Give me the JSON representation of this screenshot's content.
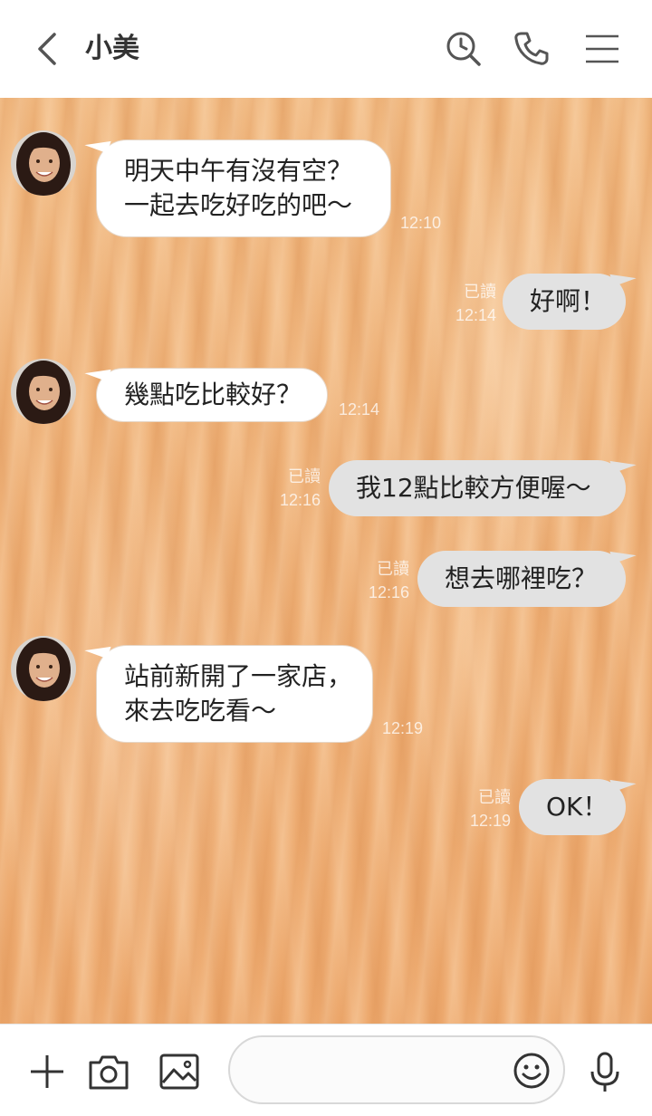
{
  "header": {
    "contact_name": "小美",
    "icons": [
      "back-icon",
      "search-history-icon",
      "phone-icon",
      "menu-icon"
    ]
  },
  "messages": [
    {
      "side": "in",
      "text": "明天中午有沒有空？\n一起去吃好吃的吧～",
      "time": "12:10"
    },
    {
      "side": "out",
      "text": "好啊！",
      "read": "已讀",
      "time": "12:14"
    },
    {
      "side": "in",
      "text": "幾點吃比較好？",
      "time": "12:14"
    },
    {
      "side": "out",
      "text": "我12點比較方便喔～",
      "read": "已讀",
      "time": "12:16"
    },
    {
      "side": "out",
      "text": "想去哪裡吃？",
      "read": "已讀",
      "time": "12:16"
    },
    {
      "side": "in",
      "text": "站前新開了一家店，\n來去吃吃看～",
      "time": "12:19"
    },
    {
      "side": "out",
      "text": "OK！",
      "read": "已讀",
      "time": "12:19"
    }
  ],
  "footer": {
    "input_value": "",
    "icons": [
      "plus-icon",
      "camera-icon",
      "image-icon",
      "emoji-icon",
      "microphone-icon"
    ]
  },
  "colors": {
    "incoming_bubble": "#ffffff",
    "outgoing_bubble": "#e2e2e2",
    "wood_background": "#eeb077"
  }
}
